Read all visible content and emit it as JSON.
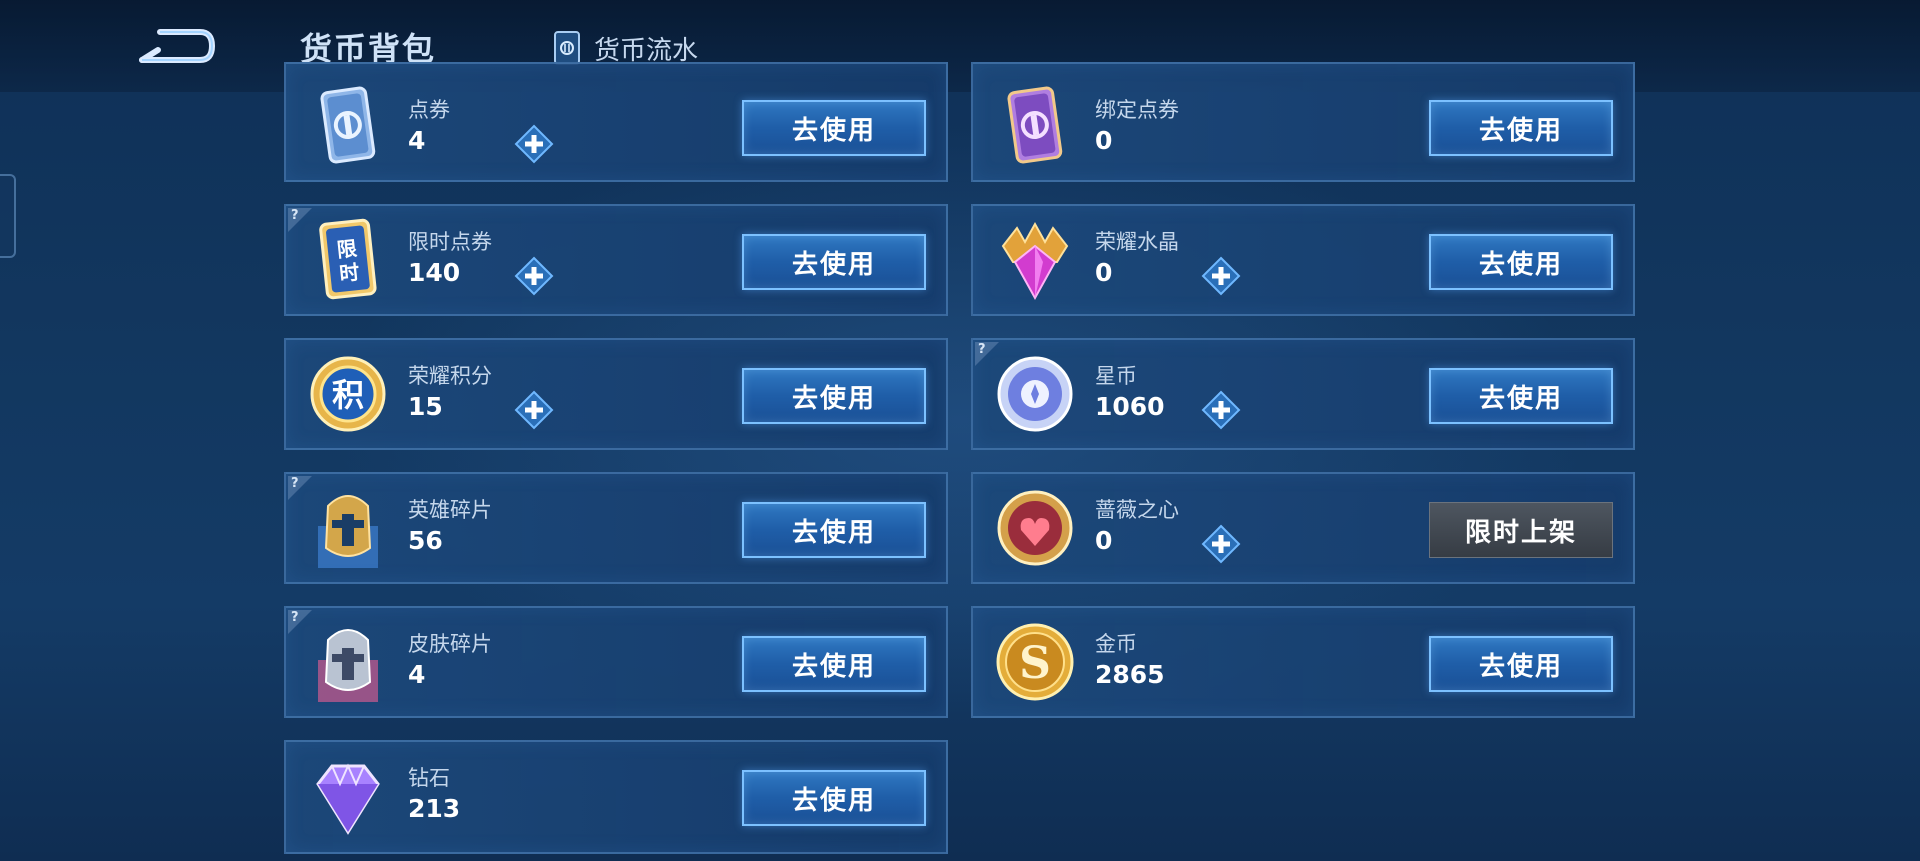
{
  "header": {
    "title": "货币背包",
    "ledger_tab_label": "货币流水"
  },
  "currencies": [
    {
      "name": "点券",
      "count": "4",
      "button": "去使用",
      "has_plus": true,
      "has_help": false,
      "icon": "blue-card-icon"
    },
    {
      "name": "绑定点券",
      "count": "0",
      "button": "去使用",
      "has_plus": false,
      "has_help": false,
      "icon": "purple-card-icon"
    },
    {
      "name": "限时点券",
      "count": "140",
      "button": "去使用",
      "has_plus": true,
      "has_help": true,
      "icon": "limited-time-card-icon",
      "icon_text": "限时"
    },
    {
      "name": "荣耀水晶",
      "count": "0",
      "button": "去使用",
      "has_plus": true,
      "has_help": false,
      "icon": "glory-crystal-icon"
    },
    {
      "name": "荣耀积分",
      "count": "15",
      "button": "去使用",
      "has_plus": true,
      "has_help": false,
      "icon": "glory-points-coin-icon",
      "icon_text": "积"
    },
    {
      "name": "星币",
      "count": "1060",
      "button": "去使用",
      "has_plus": true,
      "has_help": true,
      "icon": "star-coin-icon"
    },
    {
      "name": "英雄碎片",
      "count": "56",
      "button": "去使用",
      "has_plus": false,
      "has_help": true,
      "icon": "hero-fragment-helmet-icon"
    },
    {
      "name": "蔷薇之心",
      "count": "0",
      "button": "限时上架",
      "has_plus": true,
      "has_help": false,
      "icon": "rose-heart-coin-icon",
      "button_disabled": true
    },
    {
      "name": "皮肤碎片",
      "count": "4",
      "button": "去使用",
      "has_plus": false,
      "has_help": true,
      "icon": "skin-fragment-helmet-icon"
    },
    {
      "name": "金币",
      "count": "2865",
      "button": "去使用",
      "has_plus": false,
      "has_help": false,
      "icon": "gold-coin-icon",
      "icon_text": "S"
    },
    {
      "name": "钻石",
      "count": "213",
      "button": "去使用",
      "has_plus": false,
      "has_help": false,
      "icon": "diamond-icon"
    }
  ],
  "colors": {
    "background": "#12375f",
    "card": "#1c487a",
    "button": "#2f78c2",
    "button_border": "#7cc1ff",
    "disabled_button": "#4e5660"
  }
}
